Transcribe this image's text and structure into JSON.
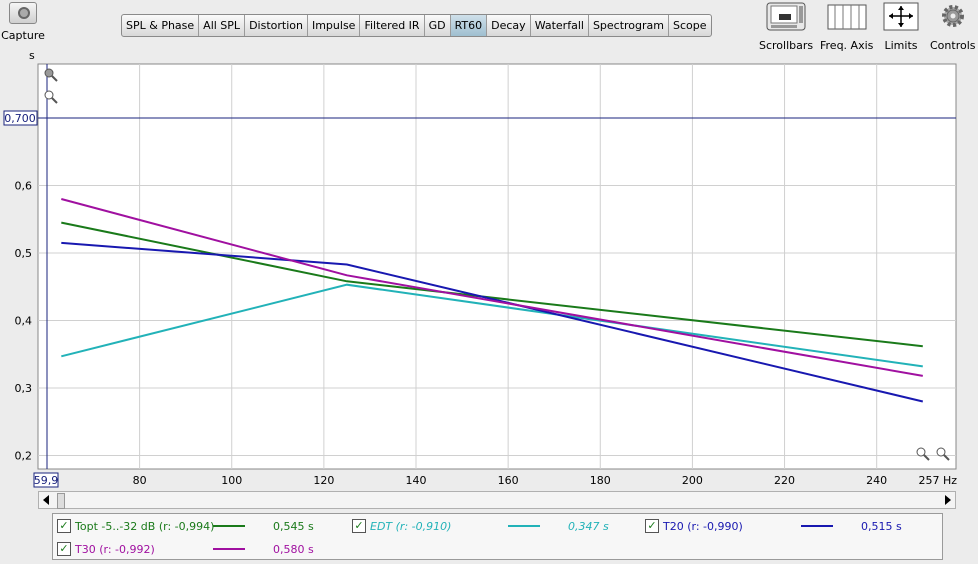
{
  "capture": {
    "label": "Capture"
  },
  "tabs": [
    {
      "label": "SPL & Phase",
      "active": false
    },
    {
      "label": "All SPL",
      "active": false
    },
    {
      "label": "Distortion",
      "active": false
    },
    {
      "label": "Impulse",
      "active": false
    },
    {
      "label": "Filtered IR",
      "active": false
    },
    {
      "label": "GD",
      "active": false
    },
    {
      "label": "RT60",
      "active": true
    },
    {
      "label": "Decay",
      "active": false
    },
    {
      "label": "Waterfall",
      "active": false
    },
    {
      "label": "Spectrogram",
      "active": false
    },
    {
      "label": "Scope",
      "active": false
    }
  ],
  "tools": {
    "scrollbars": "Scrollbars",
    "freq_axis": "Freq. Axis",
    "limits": "Limits",
    "controls": "Controls"
  },
  "colors": {
    "green": "#1a7a1a",
    "cyan": "#22b2b8",
    "blue": "#1818b0",
    "magenta": "#a010a0",
    "cursor": "#1a237e"
  },
  "cursor": {
    "y_readout": "0,700",
    "x_readout": "59,9"
  },
  "chart_data": {
    "type": "line",
    "ylabel": "s",
    "xunit": "Hz",
    "xlim": [
      59.9,
      257
    ],
    "ylim": [
      0.18,
      0.78
    ],
    "x_ticks": [
      "80",
      "100",
      "120",
      "140",
      "160",
      "180",
      "200",
      "220",
      "240",
      "257 Hz"
    ],
    "x_tick_values": [
      80,
      100,
      120,
      140,
      160,
      180,
      200,
      220,
      240,
      257
    ],
    "y_ticks": [
      "0,2",
      "0,3",
      "0,4",
      "0,5",
      "0,6"
    ],
    "y_tick_values": [
      0.2,
      0.3,
      0.4,
      0.5,
      0.6
    ],
    "series": [
      {
        "name": "Topt -5..-32 dB (r: -0,994)",
        "value": "0,545 s",
        "color": "#1a7a1a",
        "italic": false,
        "x": [
          63,
          125,
          250
        ],
        "y": [
          0.545,
          0.458,
          0.362
        ]
      },
      {
        "name": "EDT (r: -0,910)",
        "value": "0,347 s",
        "color": "#22b2b8",
        "italic": true,
        "x": [
          63,
          125,
          250
        ],
        "y": [
          0.347,
          0.453,
          0.332
        ]
      },
      {
        "name": "T20 (r: -0,990)",
        "value": "0,515 s",
        "color": "#1818b0",
        "italic": false,
        "x": [
          63,
          125,
          250
        ],
        "y": [
          0.515,
          0.483,
          0.28
        ]
      },
      {
        "name": "T30 (r: -0,992)",
        "value": "0,580 s",
        "color": "#a010a0",
        "italic": false,
        "x": [
          63,
          125,
          250
        ],
        "y": [
          0.58,
          0.467,
          0.318
        ]
      }
    ]
  }
}
